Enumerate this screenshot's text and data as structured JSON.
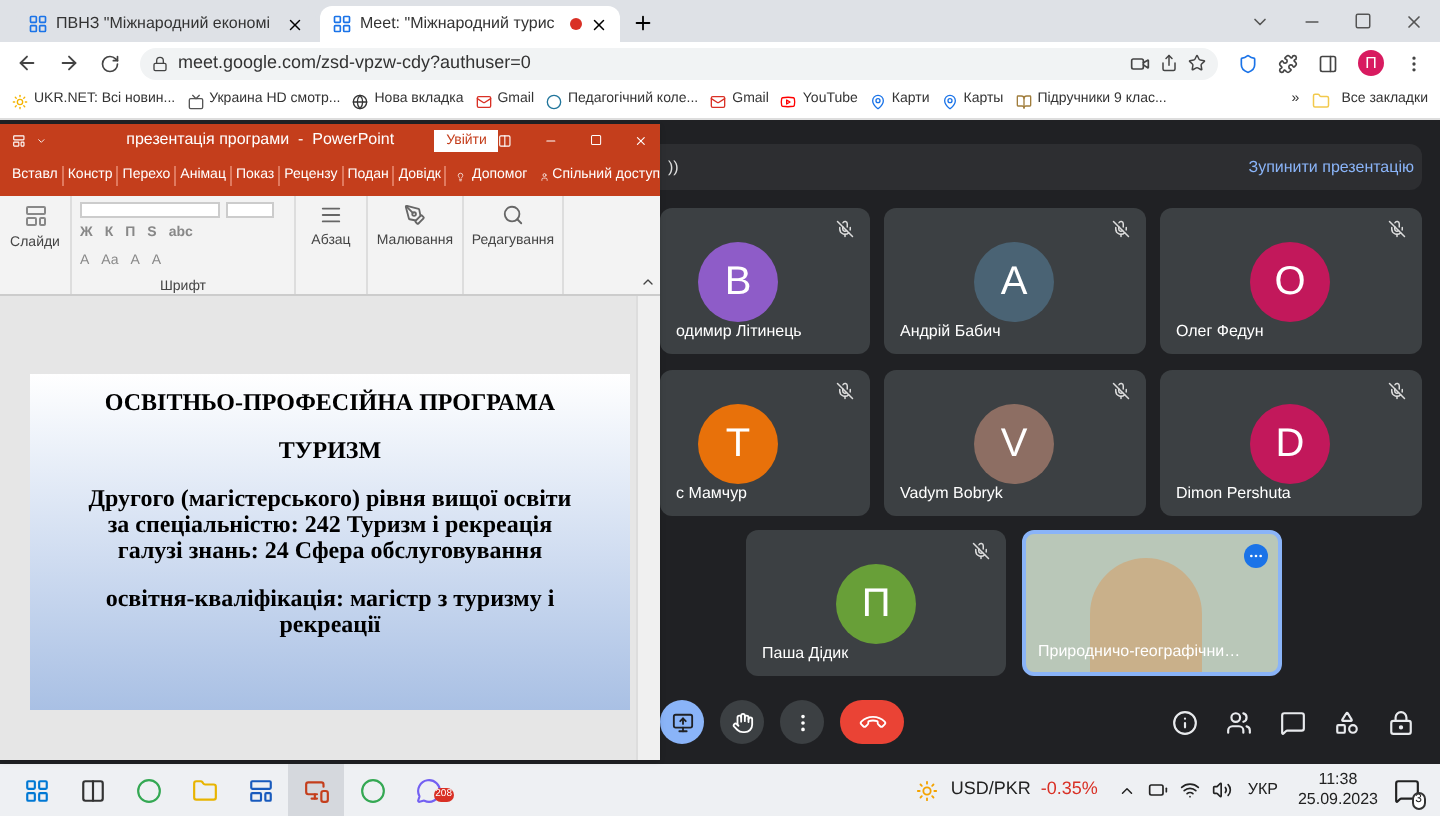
{
  "browser": {
    "tabs": [
      {
        "title": "ПВНЗ \"Міжнародний економі",
        "selected": false,
        "recording": false
      },
      {
        "title": "Meet: \"Міжнародний турис",
        "selected": true,
        "recording": true
      }
    ],
    "url": "meet.google.com/zsd-vpzw-cdy?authuser=0",
    "profile_initial": "П",
    "bookmarks": [
      {
        "label": "UKR.NET: Всі новин...",
        "kind": "sun"
      },
      {
        "label": "Украина HD смотр...",
        "kind": "tv"
      },
      {
        "label": "Нова вкладка",
        "kind": "globe"
      },
      {
        "label": "Gmail",
        "kind": "mail"
      },
      {
        "label": "Педагогічний коле...",
        "kind": "wordpress"
      },
      {
        "label": "Gmail",
        "kind": "mail"
      },
      {
        "label": "YouTube",
        "kind": "video"
      },
      {
        "label": "Карти",
        "kind": "pin"
      },
      {
        "label": "Карты",
        "kind": "pin"
      },
      {
        "label": "Підручники 9 клас...",
        "kind": "book"
      }
    ],
    "more_bookmarks": "»",
    "all_bookmarks": "Все закладки"
  },
  "powerpoint": {
    "title": "презентація програми  -  PowerPoint",
    "sign_in": "Увійти",
    "tabs": [
      "Вставл",
      "Констр",
      "Перехо",
      "Анімац",
      "Показ",
      "Рецензу",
      "Подан",
      "Довідк"
    ],
    "help": "Допомог",
    "share": "Спільний доступ",
    "ribbon": {
      "slides": "Слайди",
      "font_row_1": [
        "Ж",
        "К",
        "П",
        "S",
        "abc"
      ],
      "font_row_2": [
        "A",
        "Aa",
        "A",
        "A"
      ],
      "font": "Шрифт",
      "paragraph": "Абзац",
      "drawing": "Малювання",
      "editing": "Редагування"
    },
    "slide": [
      [
        "ОСВІТНЬО-ПРОФЕСІЙНА ПРОГРАМА"
      ],
      [
        "ТУРИЗМ"
      ],
      [
        "Другого (магістерського) рівня вищої освіти",
        "за спеціальністю: 242 Туризм і рекреація",
        "галузі знань: 24 Сфера обслуговування"
      ],
      [
        "освітня-кваліфікація: магістр з туризму і рекреації"
      ]
    ]
  },
  "meet": {
    "presenting": {
      "label": "))",
      "stop": "Зупинити презентацію"
    },
    "participants": [
      {
        "name": "одимир Літинець",
        "initial": "В",
        "color": "#8e5cc8",
        "muted": true
      },
      {
        "name": "Андрій Бабич",
        "initial": "А",
        "color": "#4a6374",
        "muted": true
      },
      {
        "name": "Олег Федун",
        "initial": "О",
        "color": "#c2185b",
        "muted": true
      },
      {
        "name": "с Мамчур",
        "initial": "Т",
        "color": "#e8710a",
        "muted": true
      },
      {
        "name": "Vadym Bobryk",
        "initial": "V",
        "color": "#8d6e63",
        "muted": true
      },
      {
        "name": "Dimon Pershuta",
        "initial": "D",
        "color": "#c2185b",
        "muted": true
      },
      {
        "name": "Паша Дідик",
        "initial": "П",
        "color": "#689f38",
        "muted": true
      }
    ],
    "self": {
      "name": "Природничо-географічни…"
    },
    "controls": [
      {
        "kind": "present",
        "active": true
      },
      {
        "kind": "hand",
        "active": false
      },
      {
        "kind": "more",
        "active": false
      },
      {
        "kind": "end",
        "active": false
      }
    ],
    "side_controls": [
      {
        "kind": "info"
      },
      {
        "kind": "people"
      },
      {
        "kind": "chat"
      },
      {
        "kind": "activities"
      },
      {
        "kind": "lock"
      }
    ]
  },
  "taskbar": {
    "apps": [
      {
        "kind": "start",
        "active": false
      },
      {
        "kind": "taskview",
        "active": false
      },
      {
        "kind": "chrome",
        "active": false
      },
      {
        "kind": "folder",
        "active": false
      },
      {
        "kind": "word",
        "active": false
      },
      {
        "kind": "powerpoint",
        "active": true
      },
      {
        "kind": "chrome",
        "active": false
      },
      {
        "kind": "viber",
        "active": false,
        "badge": "208"
      }
    ],
    "ticker": {
      "pair": "USD/PKR",
      "change": "-0.35%"
    },
    "language": "УКР",
    "time": "11:38",
    "date": "25.09.2023",
    "notifications": "3"
  }
}
